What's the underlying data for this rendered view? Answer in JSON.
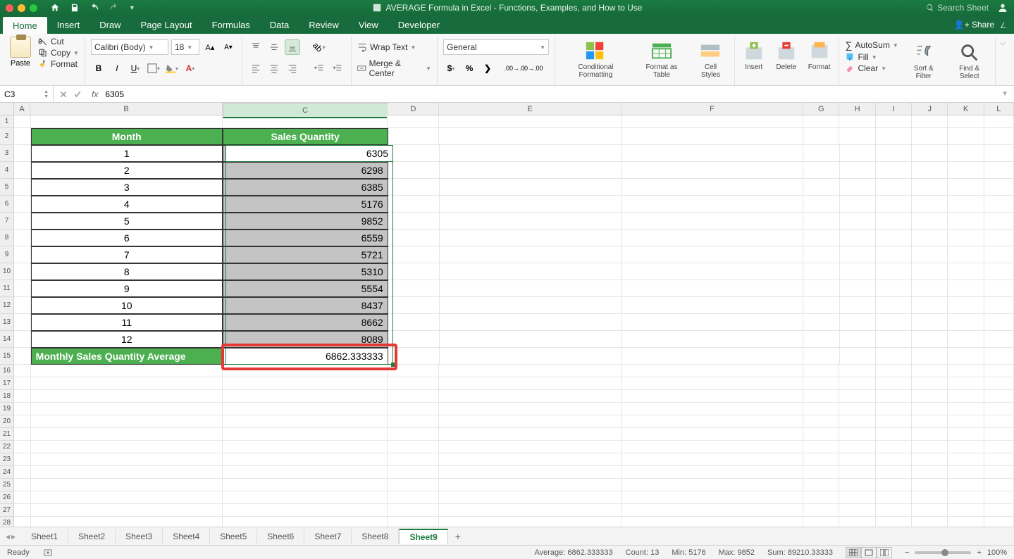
{
  "title": "AVERAGE Formula in Excel - Functions, Examples, and How to Use",
  "search_placeholder": "Search Sheet",
  "tabs": [
    "Home",
    "Insert",
    "Draw",
    "Page Layout",
    "Formulas",
    "Data",
    "Review",
    "View",
    "Developer"
  ],
  "active_tab": "Home",
  "share_label": "Share",
  "clipboard": {
    "paste": "Paste",
    "cut": "Cut",
    "copy": "Copy",
    "format": "Format"
  },
  "font": {
    "name": "Calibri (Body)",
    "size": "18"
  },
  "align": {
    "wrap": "Wrap Text",
    "merge": "Merge & Center"
  },
  "number_format": "General",
  "styles": {
    "cond": "Conditional Formatting",
    "table": "Format as Table",
    "cell": "Cell Styles"
  },
  "cells": {
    "insert": "Insert",
    "delete": "Delete",
    "format": "Format"
  },
  "editing": {
    "autosum": "AutoSum",
    "fill": "Fill",
    "clear": "Clear",
    "sort": "Sort & Filter",
    "find": "Find & Select"
  },
  "namebox": "C3",
  "formula_value": "6305",
  "columns": [
    "A",
    "B",
    "C",
    "D",
    "E",
    "F",
    "G",
    "H",
    "I",
    "J",
    "K",
    "L"
  ],
  "col_widths": {
    "A": 24,
    "B": 276,
    "C": 238,
    "D": 74,
    "E": 262,
    "F": 262,
    "G": 52,
    "H": 52,
    "I": 52,
    "J": 52,
    "K": 52,
    "L": 43
  },
  "row_count": 29,
  "headers": {
    "b": "Month",
    "c": "Sales Quantity"
  },
  "data_rows": [
    {
      "b": "1",
      "c": "6305"
    },
    {
      "b": "2",
      "c": "6298"
    },
    {
      "b": "3",
      "c": "6385"
    },
    {
      "b": "4",
      "c": "5176"
    },
    {
      "b": "5",
      "c": "9852"
    },
    {
      "b": "6",
      "c": "6559"
    },
    {
      "b": "7",
      "c": "5721"
    },
    {
      "b": "8",
      "c": "5310"
    },
    {
      "b": "9",
      "c": "5554"
    },
    {
      "b": "10",
      "c": "8437"
    },
    {
      "b": "11",
      "c": "8662"
    },
    {
      "b": "12",
      "c": "8089"
    }
  ],
  "footer": {
    "label": "Monthly Sales Quantity Average",
    "value": "6862.333333"
  },
  "sheets": [
    "Sheet1",
    "Sheet2",
    "Sheet3",
    "Sheet4",
    "Sheet5",
    "Sheet6",
    "Sheet7",
    "Sheet8",
    "Sheet9"
  ],
  "active_sheet": "Sheet9",
  "status": {
    "ready": "Ready",
    "avg": "Average: 6862.333333",
    "count": "Count: 13",
    "min": "Min: 5176",
    "max": "Max: 9852",
    "sum": "Sum: 89210.33333",
    "zoom": "100%"
  }
}
